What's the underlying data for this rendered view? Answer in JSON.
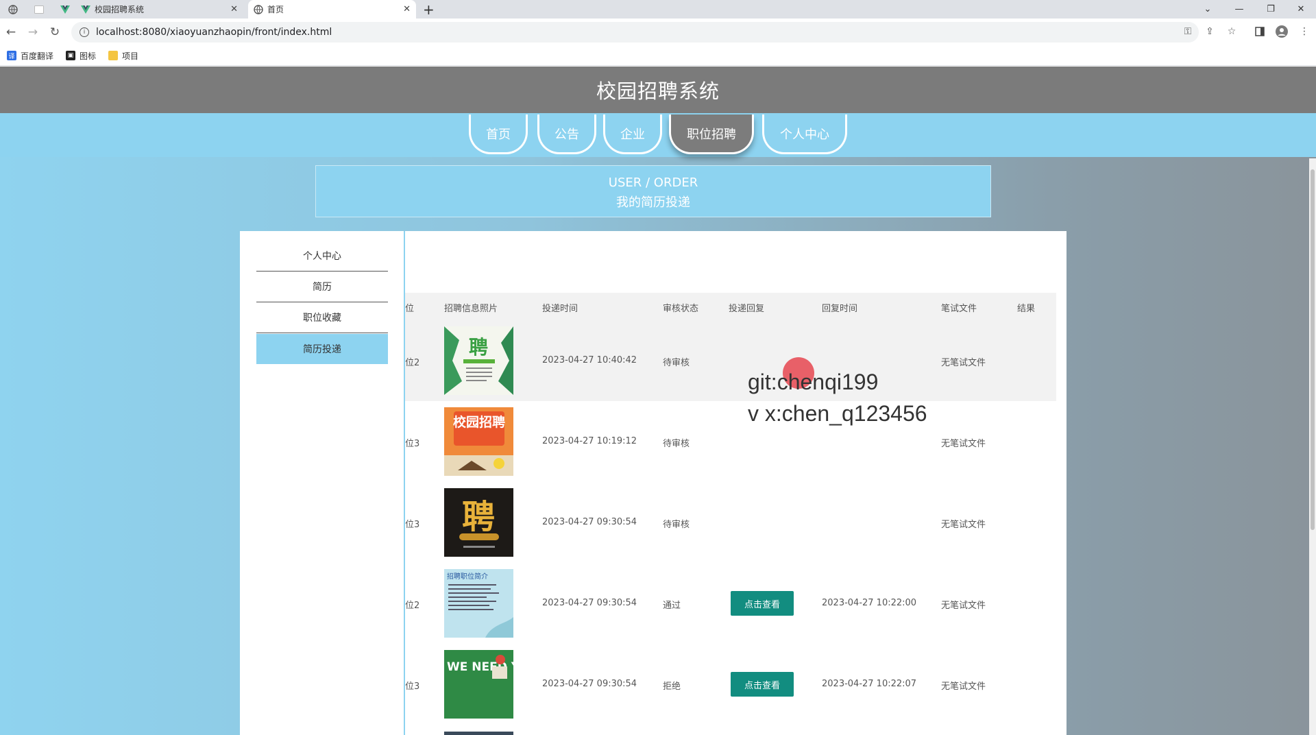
{
  "browser": {
    "tabs": [
      {
        "title": "校园招聘系统"
      },
      {
        "title": "首页"
      }
    ],
    "url": "localhost:8080/xiaoyuanzhaopin/front/index.html",
    "bookmarks": [
      "百度翻译",
      "图标",
      "项目"
    ]
  },
  "site": {
    "title": "校园招聘系统",
    "nav": [
      "首页",
      "公告",
      "企业",
      "职位招聘",
      "个人中心"
    ],
    "active_nav": "职位招聘"
  },
  "banner": {
    "en": "USER / ORDER",
    "cn": "我的简历投递"
  },
  "sidebar": {
    "items": [
      "个人中心",
      "简历",
      "职位收藏",
      "简历投递"
    ],
    "active": "简历投递"
  },
  "table": {
    "headers": [
      "位",
      "招聘信息照片",
      "投递时间",
      "审核状态",
      "投递回复",
      "回复时间",
      "笔试文件",
      "结果"
    ],
    "view_button_label": "点击查看",
    "rows": [
      {
        "position": "位2",
        "time": "2023-04-27 10:40:42",
        "status": "待审核",
        "reply": "",
        "reply_time": "",
        "exam": "无笔试文件",
        "poster": "聘"
      },
      {
        "position": "位3",
        "time": "2023-04-27 10:19:12",
        "status": "待审核",
        "reply": "",
        "reply_time": "",
        "exam": "无笔试文件",
        "poster": "校园招聘"
      },
      {
        "position": "位3",
        "time": "2023-04-27 09:30:54",
        "status": "待审核",
        "reply": "",
        "reply_time": "",
        "exam": "无笔试文件",
        "poster": "聘"
      },
      {
        "position": "位2",
        "time": "2023-04-27 09:30:54",
        "status": "通过",
        "reply": "点击查看",
        "reply_time": "2023-04-27 10:22:00",
        "exam": "无笔试文件",
        "poster": "招聘职位简介"
      },
      {
        "position": "位3",
        "time": "2023-04-27 09:30:54",
        "status": "拒绝",
        "reply": "点击查看",
        "reply_time": "2023-04-27 10:22:07",
        "exam": "无笔试文件",
        "poster": "WE NEED YOU 聘"
      }
    ]
  },
  "watermark": {
    "line1": "git:chenqi199",
    "line2": "v x:chen_q123456"
  }
}
